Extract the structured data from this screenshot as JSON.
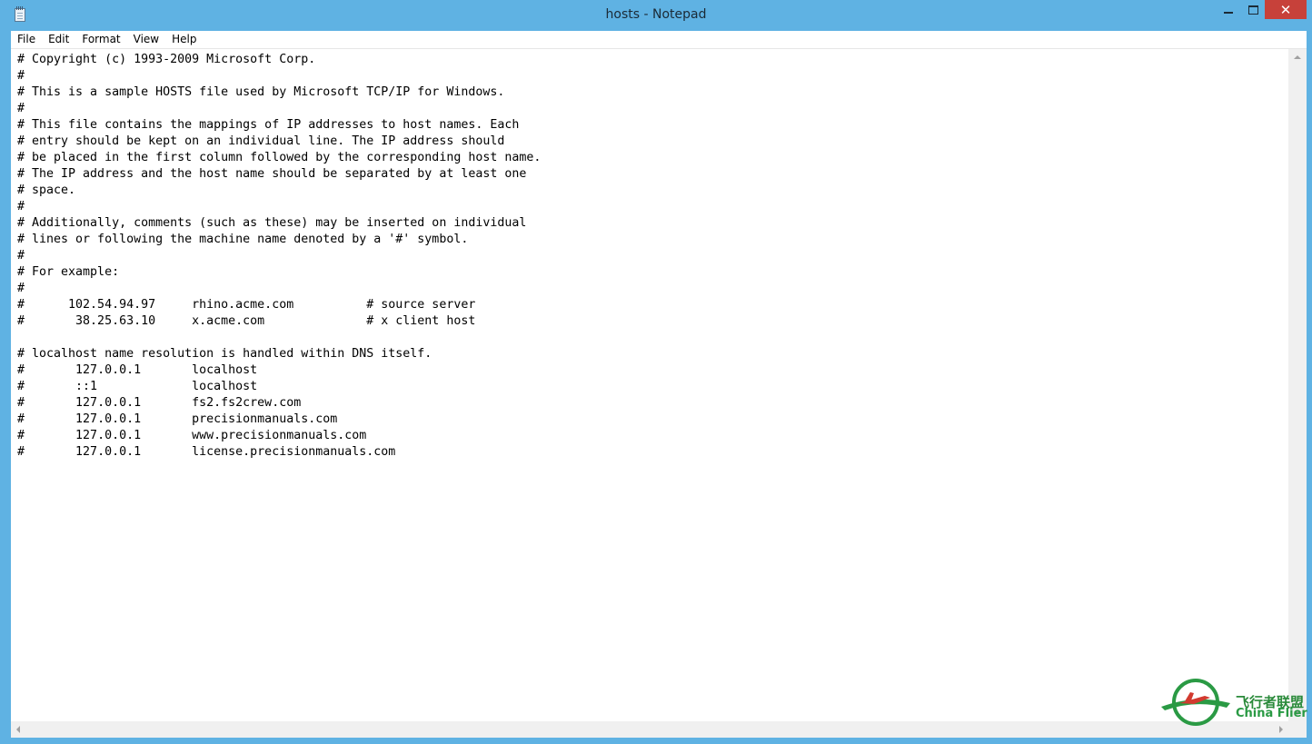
{
  "window": {
    "title": "hosts - Notepad",
    "close_glyph": "✕"
  },
  "menu": [
    "File",
    "Edit",
    "Format",
    "View",
    "Help"
  ],
  "editor": {
    "content": "# Copyright (c) 1993-2009 Microsoft Corp.\n#\n# This is a sample HOSTS file used by Microsoft TCP/IP for Windows.\n#\n# This file contains the mappings of IP addresses to host names. Each\n# entry should be kept on an individual line. The IP address should\n# be placed in the first column followed by the corresponding host name.\n# The IP address and the host name should be separated by at least one\n# space.\n#\n# Additionally, comments (such as these) may be inserted on individual\n# lines or following the machine name denoted by a '#' symbol.\n#\n# For example:\n#\n#      102.54.94.97     rhino.acme.com          # source server\n#       38.25.63.10     x.acme.com              # x client host\n\n# localhost name resolution is handled within DNS itself.\n#\t127.0.0.1       localhost\n#\t::1             localhost\n#\t127.0.0.1       fs2.fs2crew.com\n#\t127.0.0.1       precisionmanuals.com\n#\t127.0.0.1       www.precisionmanuals.com\n#\t127.0.0.1       license.precisionmanuals.com"
  },
  "watermark": {
    "cn_text": "飞行者联盟",
    "en_text": "China Flier"
  },
  "colors": {
    "title_bar": "#5fb2e3",
    "close_button": "#c7413a",
    "watermark_green": "#2a8a3a"
  },
  "icons": [
    "notepad-icon",
    "minimize-icon",
    "maximize-icon",
    "close-icon",
    "scroll-up-icon",
    "scroll-down-icon",
    "scroll-left-icon",
    "scroll-right-icon",
    "china-flier-logo"
  ]
}
